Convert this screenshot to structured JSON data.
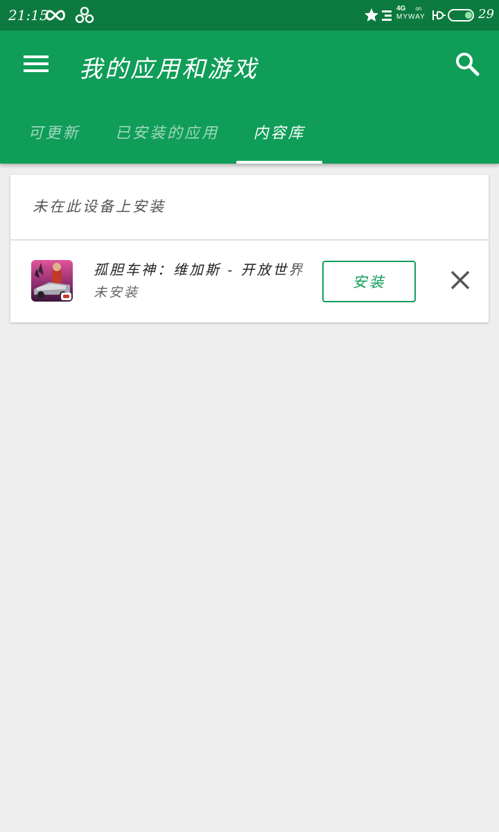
{
  "status_bar": {
    "time": "21:15",
    "network_type": "4G",
    "carrier": "MYWAY",
    "network_extra": "on",
    "battery_level": "29",
    "icons": [
      "infinity-icon",
      "cloud-icon",
      "star-icon",
      "list-icon",
      "charging-icon",
      "battery-icon"
    ]
  },
  "app_bar": {
    "title": "我的应用和游戏",
    "menu_icon": "hamburger-menu-icon",
    "search_icon": "search-icon"
  },
  "tabs": [
    {
      "label": "可更新",
      "active": false
    },
    {
      "label": "已安装的应用",
      "active": false
    },
    {
      "label": "内容库",
      "active": true
    }
  ],
  "library": {
    "section_title": "未在此设备上安装",
    "apps": [
      {
        "name": "孤胆车神：维加斯 - 开放世界",
        "status": "未安装",
        "install_label": "安装",
        "icon": "game-app-icon",
        "dismiss_icon": "close-icon"
      }
    ]
  },
  "colors": {
    "primary": "#0f9d58",
    "status_bar": "#0c7a3e",
    "background": "#eeeeee"
  }
}
